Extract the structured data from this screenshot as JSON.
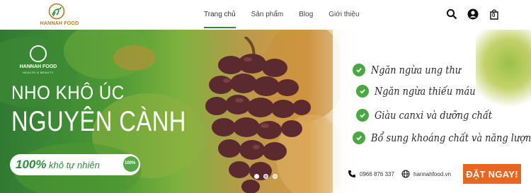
{
  "header": {
    "logo_text": "HANNAH FOOD",
    "nav": [
      "Trang chủ",
      "Sản phẩm",
      "Blog",
      "Giới thiệu"
    ],
    "active_nav": "Trang chủ",
    "cart_count": "0",
    "icons": [
      "search-icon",
      "user-icon",
      "cart-icon"
    ]
  },
  "banner": {
    "brand": {
      "name": "HANNAH FOOD",
      "tagline": "HEALTH & BEAUTY"
    },
    "headline_line1": "NHO KHÔ ÚC",
    "headline_line2": "NGUYÊN CÀNH",
    "badge": {
      "percent": "100%",
      "text": "khô tự nhiên",
      "seal_text": "100%"
    },
    "benefits": [
      "Ngăn ngừa ung thư",
      "Ngăn ngừa thiếu máu",
      "Giàu canxi và dưỡng chất",
      "Bổ sung khoáng chất và năng lượng"
    ],
    "phone": "0966 876 337",
    "website": "hannahfood.vn",
    "cta": "ĐẶT NGAY!",
    "slides": {
      "total": 3,
      "active": 1
    }
  },
  "colors": {
    "green": "#2e8b3a",
    "cta_orange": "#e8661f",
    "check_green": "#4aa843"
  }
}
